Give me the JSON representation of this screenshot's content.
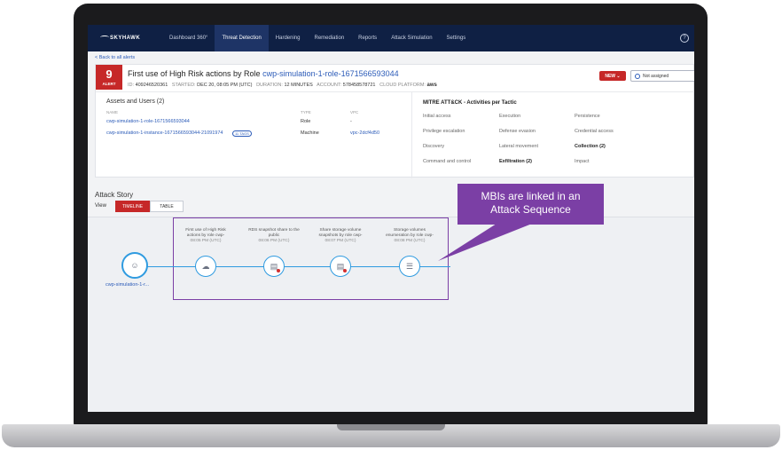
{
  "nav": {
    "logo": "SKYHAWK",
    "items": [
      {
        "label": "Dashboard 360°",
        "active": false
      },
      {
        "label": "Threat Detection",
        "active": true
      },
      {
        "label": "Hardening",
        "active": false
      },
      {
        "label": "Remediation",
        "active": false
      },
      {
        "label": "Reports",
        "active": false
      },
      {
        "label": "Attack Simulation",
        "active": false
      },
      {
        "label": "Settings",
        "active": false
      }
    ],
    "help": "?"
  },
  "back_link": "< Back to all alerts",
  "alert": {
    "severity_number": "9",
    "severity_label": "ALERT",
    "title_prefix": "First use of High Risk actions by Role",
    "title_link": "cwp-simulation-1-role-1671566593044",
    "meta": {
      "id_label": "ID:",
      "id": "409246520361",
      "started_label": "STARTED:",
      "started": "DEC 20, 08:05 PM (UTC)",
      "duration_label": "DURATION:",
      "duration": "12 MINUTES",
      "account_label": "ACCOUNT:",
      "account": "578458578721",
      "platform_label": "CLOUD PLATFORM:",
      "platform": "aws"
    },
    "status_button": "NEW",
    "assignee": "Not assigned"
  },
  "assets": {
    "title": "Assets and Users (2)",
    "columns": {
      "name": "NAME",
      "type": "TYPE",
      "vpc": "VPC"
    },
    "rows": [
      {
        "name": "cwp-simulation-1-role-1671566593044",
        "type": "Role",
        "vpc": "-"
      },
      {
        "name": "cwp-simulation-1-instance-1671566593044-21091974",
        "tag": "11 TAGS",
        "type": "Machine",
        "vpc": "vpc-2dcf4d50"
      }
    ]
  },
  "mitre": {
    "title": "MITRE ATT&CK - Activities per Tactic",
    "tactics": [
      {
        "label": "Initial access",
        "bold": false
      },
      {
        "label": "Execution",
        "bold": false
      },
      {
        "label": "Persistence",
        "bold": false
      },
      {
        "label": "Privilege escalation",
        "bold": false
      },
      {
        "label": "Defense evasion",
        "bold": false
      },
      {
        "label": "Credential access",
        "bold": false
      },
      {
        "label": "Discovery",
        "bold": false
      },
      {
        "label": "Lateral movement",
        "bold": false
      },
      {
        "label": "Collection (2)",
        "bold": true
      },
      {
        "label": "Command and control",
        "bold": false
      },
      {
        "label": "Exfiltration (2)",
        "bold": true
      },
      {
        "label": "Impact",
        "bold": false
      }
    ]
  },
  "attack_story": {
    "title": "Attack Story",
    "view_label": "View",
    "tabs": [
      {
        "label": "TIMELINE",
        "active": true
      },
      {
        "label": "TABLE",
        "active": false
      }
    ],
    "actor": "cwp-simulation-1-r...",
    "events": [
      {
        "line1": "First use of High Risk",
        "line2": "actions by role cwp-",
        "time": "08:05 PM (UTC)",
        "icon": "cloud-icon"
      },
      {
        "line1": "RDS snapshot share to the",
        "line2": "public",
        "time": "08:06 PM (UTC)",
        "icon": "document-alert-icon"
      },
      {
        "line1": "Share storage volume",
        "line2": "snapshots by role cwp-",
        "time": "08:07 PM (UTC)",
        "icon": "document-alert-icon"
      },
      {
        "line1": "Storage volumes",
        "line2": "enumeration by role cwp-",
        "time": "08:08 PM (UTC)",
        "icon": "list-search-icon"
      }
    ]
  },
  "callout": {
    "line1": "MBIs are linked in an",
    "line2": "Attack Sequence"
  },
  "colors": {
    "nav": "#0f2044",
    "alert_red": "#c62828",
    "link": "#2b5bb8",
    "timeline": "#2f9be0",
    "callout": "#7b3fa5"
  }
}
